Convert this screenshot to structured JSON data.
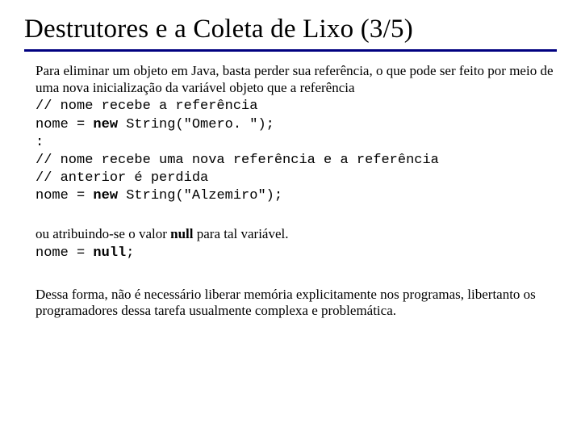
{
  "title": "Destrutores e a Coleta de Lixo (3/5)",
  "p1": "Para eliminar um objeto em Java, basta perder sua referência, o que pode ser feito por meio de uma nova inicialização da variável objeto que a referência",
  "code1": {
    "l1": "// nome recebe a referência",
    "l2a": "nome = ",
    "l2kw": "new",
    "l2b": " String(\"Omero. \");",
    "l3": ":",
    "l4": "// nome recebe uma nova referência e a referência",
    "l5": "// anterior é perdida",
    "l6a": "nome = ",
    "l6kw": "new",
    "l6b": " String(\"Alzemiro\");"
  },
  "p2a": "ou atribuindo-se o valor ",
  "p2kw": "null",
  "p2b": " para tal variável.",
  "code2": {
    "a": "nome = ",
    "kw": "null",
    "b": ";"
  },
  "p3": "Dessa forma, não é necessário liberar memória explicitamente nos programas, libertanto os programadores dessa tarefa usualmente complexa e problemática."
}
